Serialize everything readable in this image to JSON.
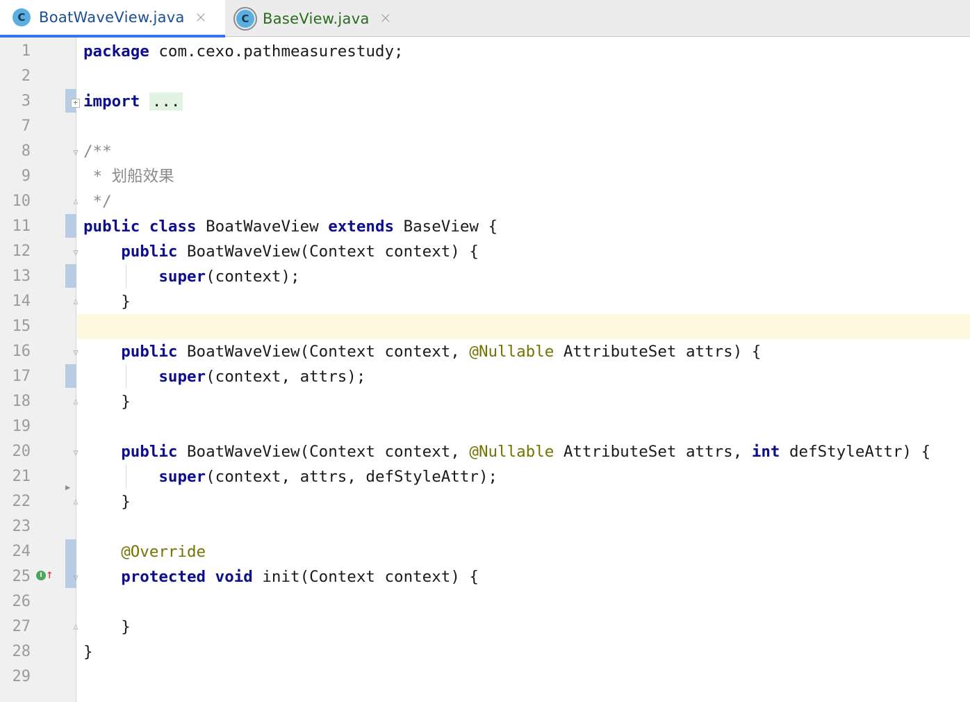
{
  "tabs": [
    {
      "label": "BoatWaveView.java",
      "icon": "C",
      "active": true
    },
    {
      "label": "BaseView.java",
      "icon": "C",
      "active": false
    }
  ],
  "close_glyph": "×",
  "line_numbers": [
    "1",
    "2",
    "3",
    "7",
    "8",
    "9",
    "10",
    "11",
    "12",
    "13",
    "14",
    "15",
    "16",
    "17",
    "18",
    "19",
    "20",
    "21",
    "22",
    "23",
    "24",
    "25",
    "26",
    "27",
    "28",
    "29"
  ],
  "code": {
    "l1_kw": "package",
    "l1_rest": " com.cexo.pathmeasurestudy;",
    "l3_kw": "import",
    "l3_folded": "...",
    "l8": "/**",
    "l9": " * 划船效果",
    "l10": " */",
    "l11_kw1": "public",
    "l11_kw2": "class",
    "l11_name": " BoatWaveView ",
    "l11_kw3": "extends",
    "l11_rest": " BaseView {",
    "l12_kw": "public",
    "l12_rest": " BoatWaveView(Context context) {",
    "l13_kw": "super",
    "l13_rest": "(context);",
    "close_brace": "}",
    "l16_kw": "public",
    "l16_a": " BoatWaveView(Context context, ",
    "l16_ann": "@Nullable",
    "l16_b": " AttributeSet attrs) {",
    "l17_kw": "super",
    "l17_rest": "(context, attrs);",
    "l20_kw": "public",
    "l20_a": " BoatWaveView(Context context, ",
    "l20_ann": "@Nullable",
    "l20_b": " AttributeSet attrs, ",
    "l20_kw2": "int",
    "l20_c": " defStyleAttr) {",
    "l21_kw": "super",
    "l21_rest": "(context, attrs, defStyleAttr);",
    "l24_ann": "@Override",
    "l25_kw1": "protected",
    "l25_kw2": "void",
    "l25_rest": " init(Context context) {"
  },
  "gutter_icons": {
    "implements_badge": "I",
    "override_arrow": "↑",
    "fold_expand": "+"
  },
  "colors": {
    "keyword": "#0d0d8f",
    "annotation": "#747300",
    "comment": "#8a8a8a",
    "current_line": "#fdf8de",
    "tab_accent": "#3574f0"
  }
}
